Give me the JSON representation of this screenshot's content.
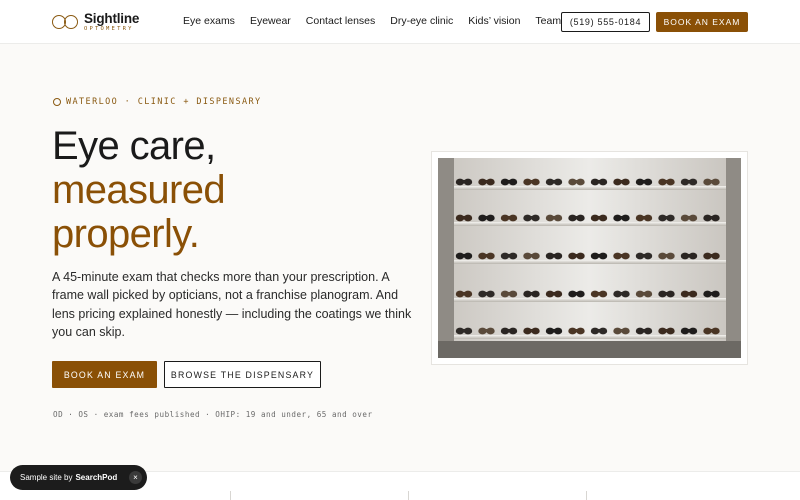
{
  "brand": {
    "name": "Sightline",
    "tagline": "OPTOMETRY",
    "accent": "#8a5006"
  },
  "nav": {
    "items": [
      "Eye exams",
      "Eyewear",
      "Contact lenses",
      "Dry-eye clinic",
      "Kids’ vision",
      "Team"
    ],
    "phone": "(519) 555-0184",
    "cta": "BOOK AN EXAM"
  },
  "hero": {
    "eyebrow": "WATERLOO · CLINIC + DISPENSARY",
    "headline": {
      "line1": "Eye care,",
      "line2": "measured",
      "line3": "properly."
    },
    "lede": "A 45-minute exam that checks more than your prescription. A frame wall picked by opticians, not a franchise planogram. And lens pricing explained honestly — including the coatings we think you can skip.",
    "primary_cta": "BOOK AN EXAM",
    "secondary_cta": "BROWSE THE DISPENSARY",
    "note": "OD · OS · exam fees published · OHIP: 19 and under, 65 and over",
    "image_subject": "eyewear-display-wall"
  },
  "toast": {
    "prefix": "Sample site by",
    "brand": "SearchPod",
    "close_icon": "close-icon"
  }
}
